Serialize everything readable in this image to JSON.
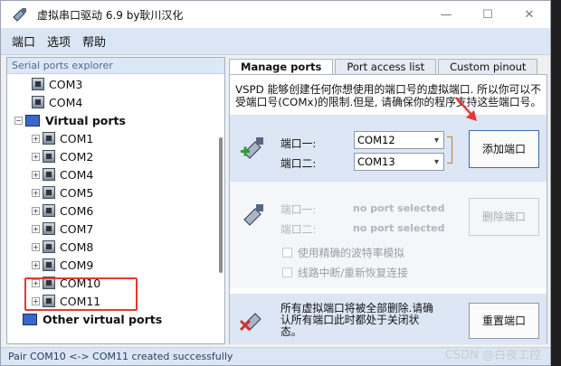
{
  "window": {
    "title": "虚拟串口驱动 6.9 by耿川汉化",
    "minimize_glyph": "—",
    "maximize_glyph": "☐",
    "close_glyph": "✕"
  },
  "menu": [
    "端口",
    "选项",
    "帮助"
  ],
  "explorer": {
    "header": "Serial ports explorer",
    "physical_ports": [
      "COM3",
      "COM4"
    ],
    "virtual_group": "Virtual ports",
    "virtual_ports": [
      "COM1",
      "COM2",
      "COM4",
      "COM5",
      "COM6",
      "COM7",
      "COM8",
      "COM9",
      "COM10",
      "COM11"
    ],
    "other_group": "Other virtual ports"
  },
  "tabs": [
    "Manage ports",
    "Port access list",
    "Custom pinout"
  ],
  "manage": {
    "description": "VSPD 能够创建任何你想使用的端口号的虚拟端口. 所以你可以不受端口号(COMx)的限制.但是, 请确保你的程序支持这些端口号。",
    "port1_label": "端口一:",
    "port2_label": "端口二:",
    "port1_value": "COM12",
    "port2_value": "COM13",
    "add_button": "添加端口",
    "remove_port1_label": "端口一:",
    "remove_port2_label": "端口二:",
    "no_port1": "no port selected",
    "no_port2": "no port selected",
    "remove_button": "删除端口",
    "strict_baud": "使用精确的波特率模拟",
    "break_reconnect": "线路中断/重新恢复连接",
    "reset_text": "所有虚拟端口将被全部删除.请确认所有端口此时都处于关闭状态。",
    "reset_button": "重置端口"
  },
  "status": "Pair COM10 <-> COM11 created successfully",
  "watermark": "CSDN @白夜工控"
}
